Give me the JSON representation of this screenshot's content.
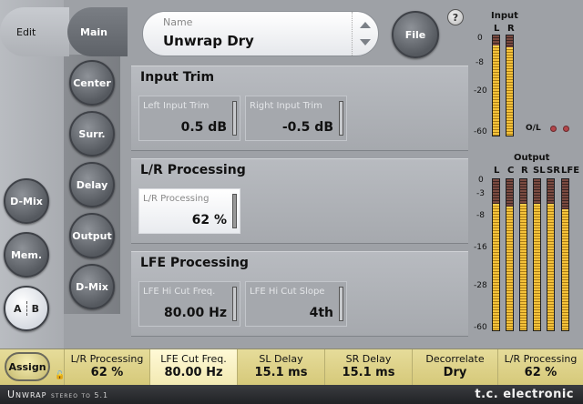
{
  "tabs": {
    "edit": "Edit",
    "main": "Main"
  },
  "side_buttons": [
    "Center",
    "Surr.",
    "Delay",
    "Output",
    "D-Mix"
  ],
  "left_buttons": {
    "dmix": "D-Mix",
    "mem": "Mem.",
    "a": "A",
    "b": "B"
  },
  "preset": {
    "label": "Name",
    "value": "Unwrap Dry"
  },
  "file_label": "File",
  "help_label": "?",
  "sections": {
    "input_trim": {
      "title": "Input Trim",
      "params": [
        {
          "label": "Left Input Trim",
          "value": "0.5 dB"
        },
        {
          "label": "Right Input Trim",
          "value": "-0.5 dB"
        }
      ]
    },
    "lr": {
      "title": "L/R Processing",
      "params": [
        {
          "label": "L/R Processing",
          "value": "62 %"
        }
      ]
    },
    "lfe": {
      "title": "LFE Processing",
      "params": [
        {
          "label": "LFE Hi Cut Freq.",
          "value": "80.00 Hz"
        },
        {
          "label": "LFE Hi Cut Slope",
          "value": "4th"
        }
      ]
    }
  },
  "meters": {
    "input": {
      "title": "Input",
      "channels": [
        "L",
        "R"
      ],
      "scale": [
        "0",
        "-8",
        "-20",
        "-60"
      ],
      "levels": [
        0.9,
        0.88
      ],
      "ol_label": "O/L"
    },
    "output": {
      "title": "Output",
      "channels": [
        "L",
        "C",
        "R",
        "SL",
        "SR",
        "LFE"
      ],
      "scale": [
        "0",
        "-3",
        "-8",
        "-16",
        "-28",
        "-60"
      ],
      "levels": [
        0.84,
        0.82,
        0.84,
        0.84,
        0.84,
        0.8
      ]
    }
  },
  "bottom": {
    "assign": "Assign",
    "softkeys": [
      {
        "label": "L/R Processing",
        "value": "62 %"
      },
      {
        "label": "LFE Cut Freq.",
        "value": "80.00 Hz"
      },
      {
        "label": "SL Delay",
        "value": "15.1 ms"
      },
      {
        "label": "SR Delay",
        "value": "15.1 ms"
      },
      {
        "label": "Decorrelate",
        "value": "Dry"
      },
      {
        "label": "L/R Processing",
        "value": "62 %"
      }
    ]
  },
  "footer": {
    "title": "Unwrap",
    "subtitle": "stereo to 5.1",
    "brand": "t.c. electronic"
  }
}
